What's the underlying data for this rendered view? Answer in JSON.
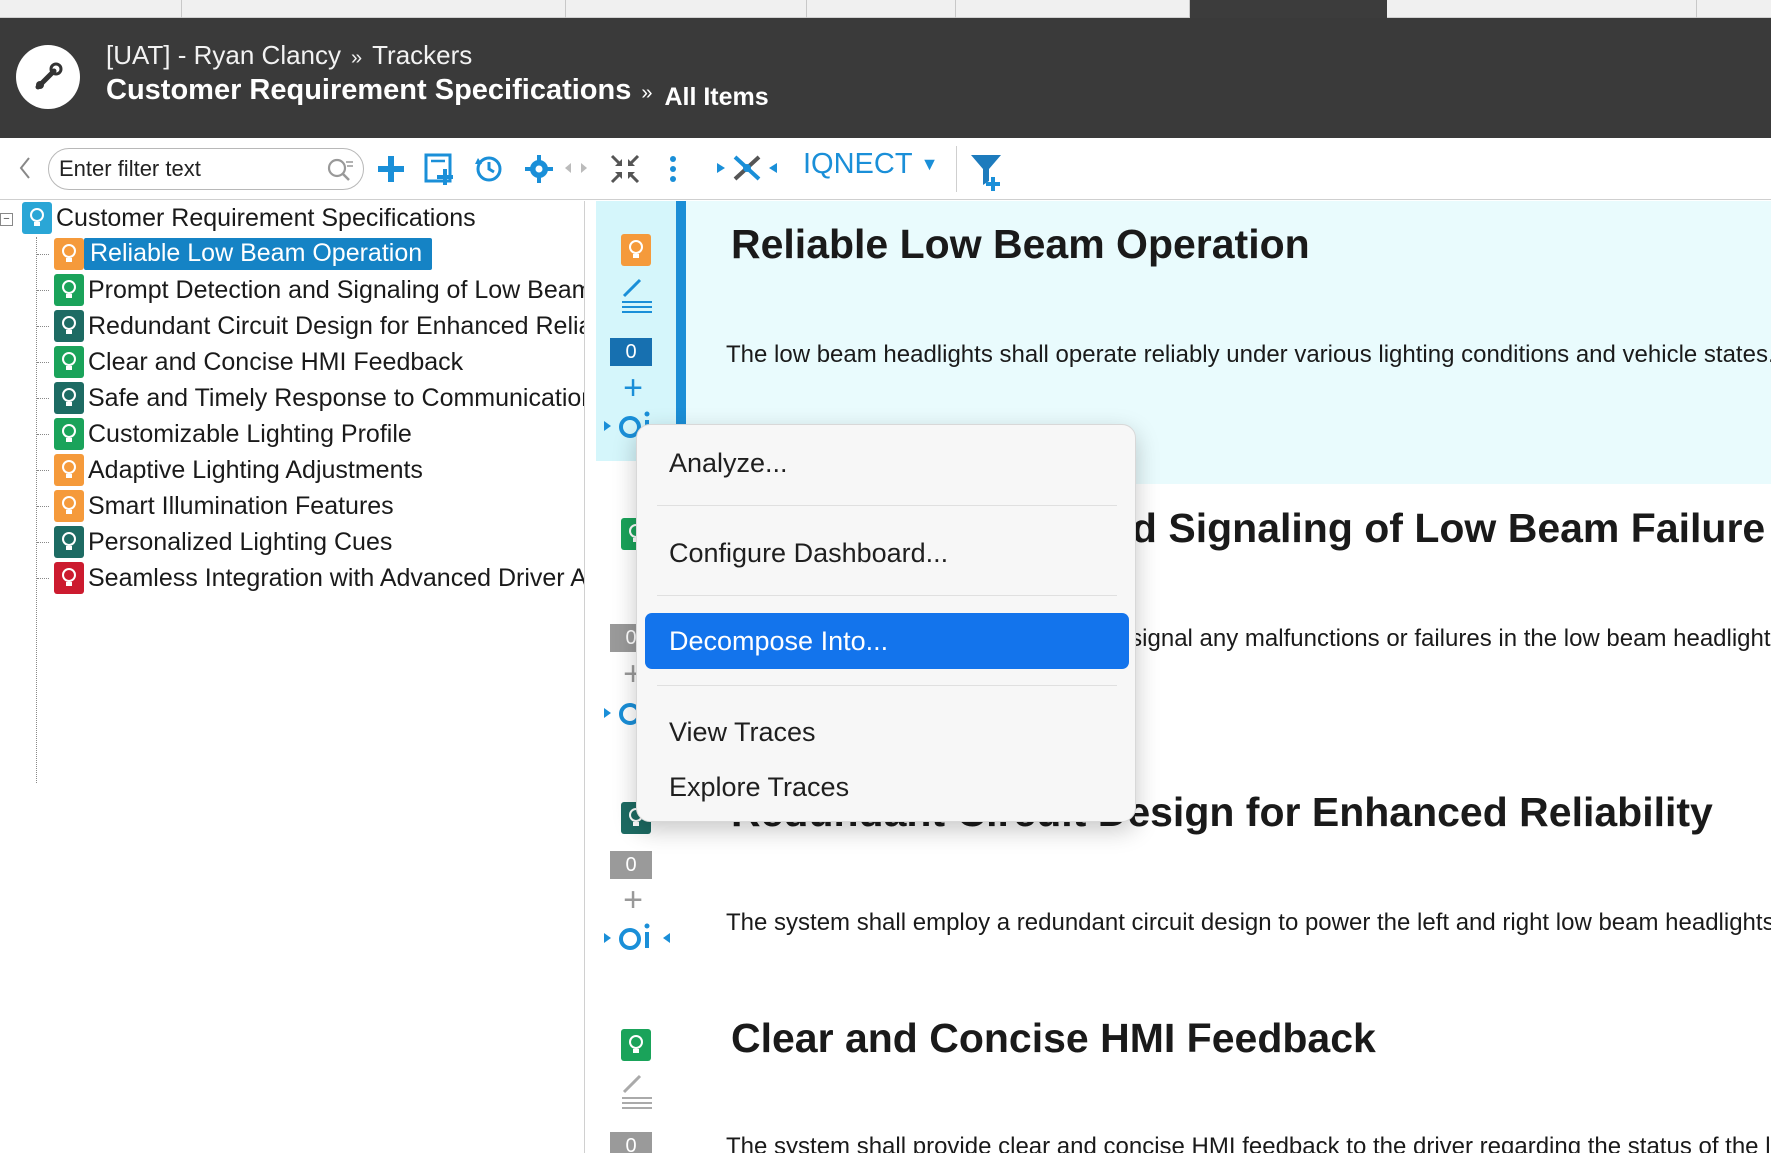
{
  "header": {
    "project": "[UAT] - Ryan Clancy",
    "breadcrumb_sep": "»",
    "section": "Trackers",
    "tracker_title": "Customer Requirement Specifications",
    "view_name": "All Items"
  },
  "toolbar": {
    "filter_placeholder": "Enter filter text",
    "iqnect_label": "IQNECT",
    "iqnect_caret": "▼"
  },
  "colors": {
    "header_bg": "#3a3a3a",
    "accent_blue": "#1583c5",
    "orange": "#f59a3b",
    "green": "#1aa35a",
    "teal": "#1d6b63",
    "red": "#cc1b2f",
    "menu_highlight": "#1374ec"
  },
  "tree": {
    "root": "Customer Requirement Specifications",
    "items": [
      {
        "label": "Reliable Low Beam Operation",
        "status": "orange",
        "selected": true
      },
      {
        "label": "Prompt Detection and Signaling of Low Beam Failure",
        "status": "green"
      },
      {
        "label": "Redundant Circuit Design for Enhanced Reliability",
        "status": "teal"
      },
      {
        "label": "Clear and Concise HMI Feedback",
        "status": "green"
      },
      {
        "label": "Safe and Timely Response to Communication",
        "status": "teal"
      },
      {
        "label": "Customizable Lighting Profile",
        "status": "green"
      },
      {
        "label": "Adaptive Lighting Adjustments",
        "status": "orange"
      },
      {
        "label": "Smart Illumination Features",
        "status": "orange"
      },
      {
        "label": "Personalized Lighting Cues",
        "status": "teal"
      },
      {
        "label": "Seamless Integration with Advanced Driver Assistance",
        "status": "red"
      }
    ]
  },
  "gutter": {
    "badge_counts": [
      "0",
      "0",
      "0",
      "0"
    ],
    "plus": "+"
  },
  "content": {
    "items": [
      {
        "title": "Reliable Low Beam Operation",
        "desc": "The low beam headlights shall operate reliably under various lighting conditions and vehicle states."
      },
      {
        "title": "Prompt Detection and Signaling of Low Beam Failure",
        "desc": "The system shall promptly detect and signal any malfunctions or failures in the low beam headlights."
      },
      {
        "title": "Redundant Circuit Design for Enhanced Reliability",
        "desc": "The system shall employ a redundant circuit design to power the left and right low beam headlights."
      },
      {
        "title": "Clear and Concise HMI Feedback",
        "desc": "The system shall provide clear and concise HMI feedback to the driver regarding the status of the low beams."
      }
    ]
  },
  "context_menu": {
    "items": [
      "Analyze...",
      "Configure Dashboard...",
      "Decompose Into...",
      "View Traces",
      "Explore Traces"
    ],
    "highlighted_index": 2
  }
}
